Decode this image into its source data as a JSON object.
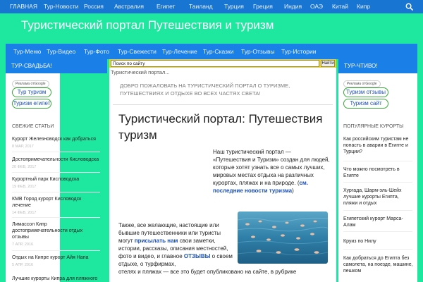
{
  "topnav": {
    "items": [
      "ГЛАВНАЯ",
      "Тур-Новости",
      "Россия",
      "Австралия",
      "Египет",
      "Таиланд",
      "Турция",
      "Греция",
      "Индия",
      "ОАЭ",
      "Китай",
      "Кипр"
    ],
    "search_icon": "search-icon"
  },
  "site": {
    "title": "Туристический портал Путешествия и туризм"
  },
  "mainmenu": {
    "items": [
      "Тур-Меню",
      "Тур-Видео",
      "Тур-Фото",
      "Тур-Свежести",
      "Тур-Лечение",
      "Тур-Сказки",
      "Тур-Отзывы",
      "Тур-Истории"
    ]
  },
  "left_sidebar": {
    "header": "ТУР-СВАДЬБА!",
    "google_label": "Реклама отGoogle",
    "buttons": [
      "Тур туризм",
      "Туризм египет"
    ],
    "recent_title": "СВЕЖИЕ СТАТЬИ",
    "posts": [
      {
        "title": "Курорт Железноводск как добраться",
        "date": "8 МАР, 2017"
      },
      {
        "title": "Достопримечательности Кисловодска",
        "date": "20 ФЕВ, 2017"
      },
      {
        "title": "Курортный парк Кисловодска",
        "date": "19 ФЕВ, 2017"
      },
      {
        "title": "КМВ Город курорт Кисловодск лечение",
        "date": "14 ФЕВ, 2017"
      },
      {
        "title": "Лимассол Кипр достопримечательности отдых отзывы",
        "date": "7 АПР, 2016"
      },
      {
        "title": "Отдых на Кипре курорт Айя Напа",
        "date": "5 АПР, 2016"
      },
      {
        "title": "Лучшие курорты Кипра для пляжного"
      }
    ]
  },
  "search": {
    "placeholder": "Поиск по сайту",
    "button": "Найти"
  },
  "breadcrumb": "Туристический портал...",
  "welcome": "Добро пожаловать на туристический портал о туризме, путешествиях и отдыхе во всех частях света!",
  "article": {
    "title": "Туристический портал: Путешествия туризм",
    "para1": "Наш туристический портал — «Путешествия и Туризм» создан для людей, которые хотят узнать все о самых лучших, мировых местах отдыха на различных курортах, пляжах и на природе. (",
    "para1_link": "см. последние новости туризма",
    "para1_end": ")",
    "para2_a": "Также, все желающие, настоящие или бывшие путешественники или туристы могут ",
    "para2_link1": "присылать нам",
    "para2_b": " свои заметки, истории, рассказы, описания местностей, фото и видео, и главное ",
    "para2_link2": "ОТЗЫВЫ",
    "para2_c": " о своем отдыхе, о турфирмах,",
    "para3": "отелях и пляжах — все это будет опубликовано на сайте, в рубрике"
  },
  "right_sidebar": {
    "header": "ТУР-ЧТИВО!",
    "google_label": "Реклама отGoogle",
    "buttons": [
      "Туризм отзывы",
      "Туризм сайт"
    ],
    "popular_title": "ПОПУЛЯРНЫЕ КУРОРТЫ",
    "posts": [
      "Как российским туристам не попасть в аварии в Египте и Турции?",
      "Что можно посмотреть в Египте",
      "Хургада, Шарм-эль-Шейх лучшие курорты Египта, пляжи и отдых",
      "Египетский курорт Марса-Алам",
      "Круиз по Нилу",
      "Как добраться до Египта без самолета, на поезде, машине, пешком"
    ]
  },
  "colors": {
    "page_bg": "#1ee8a0",
    "nav_bg": "#1876d2",
    "menu_bg": "#1a7fe6",
    "search_bar": "#f7d700",
    "link": "#1a4fb8",
    "pill_border": "#38a838"
  }
}
